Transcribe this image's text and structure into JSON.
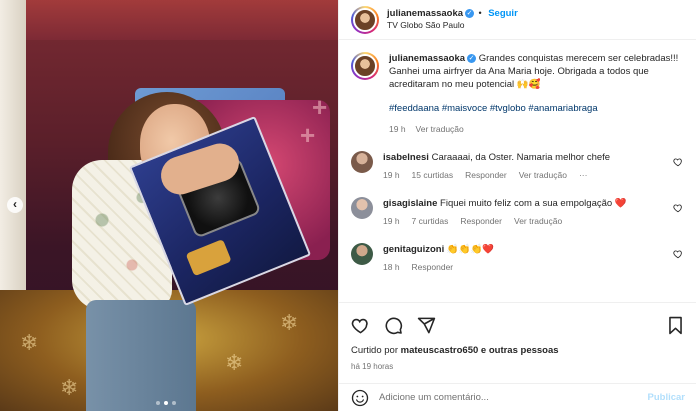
{
  "post": {
    "username": "julianemassaoka",
    "follow_label": "Seguir",
    "location": "TV Globo São Paulo"
  },
  "caption": {
    "username": "julianemassaoka",
    "text": "Grandes conquistas merecem ser celebradas!!! Ganhei uma airfryer da Ana Maria hoje. Obrigada a todos que acreditaram no meu potencial 🙌🥰",
    "hashtags": "#feeddaana #maisvoce #tvglobo #anamariabraga",
    "time": "19 h",
    "translate": "Ver tradução"
  },
  "comments": [
    {
      "username": "isabelnesi",
      "text": "Caraaaai, da Oster. Namaria melhor chefe",
      "time": "19 h",
      "likes": "15 curtidas",
      "reply": "Responder",
      "translate": "Ver tradução",
      "more": "···",
      "avatar_color": "#7a5a4a"
    },
    {
      "username": "gisagislaine",
      "text": "Fiquei muito feliz com a sua empolgação ❤️",
      "time": "19 h",
      "likes": "7 curtidas",
      "reply": "Responder",
      "translate": "Ver tradução",
      "avatar_color": "#8c8f9a"
    },
    {
      "username": "genitaguizoni",
      "text": "👏👏👏❤️",
      "time": "18 h",
      "reply": "Responder",
      "avatar_color": "#3d5a46"
    }
  ],
  "actions": {
    "liked_by_prefix": "Curtido por",
    "liked_by_user": "mateuscastro650",
    "liked_by_suffix": "e outras pessoas",
    "posted": "há 19 horas"
  },
  "add_comment": {
    "placeholder": "Adicione um comentário...",
    "publish": "Publicar"
  },
  "icons": {
    "prev": "chevron-left-icon",
    "like": "heart-icon",
    "comment": "comment-icon",
    "share": "share-icon",
    "save": "bookmark-icon",
    "emoji": "emoji-icon"
  },
  "colors": {
    "link": "#0095f6",
    "hashtag": "#00376b",
    "muted": "#737373",
    "heart_red": "#ed4956"
  }
}
